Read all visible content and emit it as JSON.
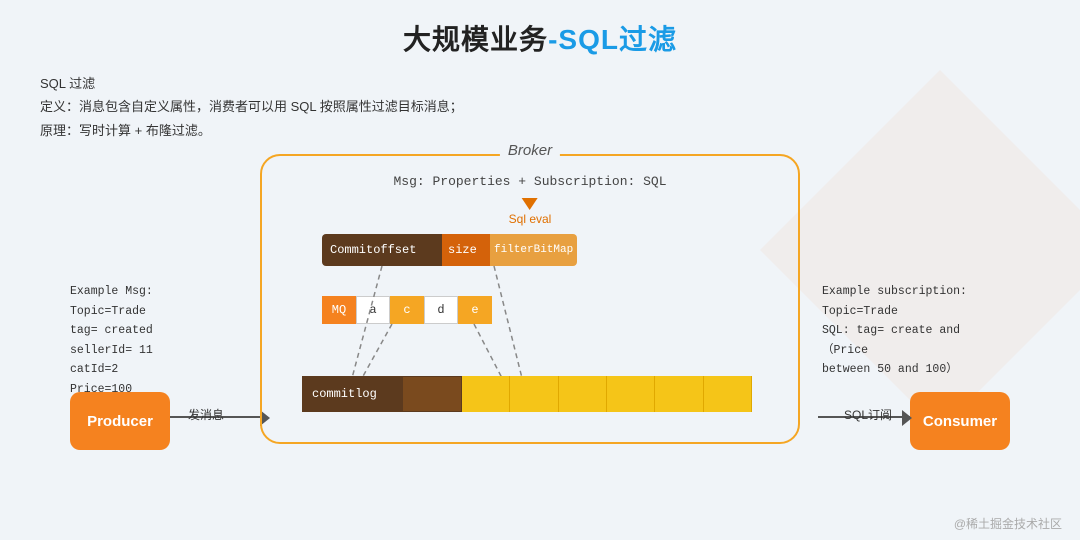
{
  "title": {
    "main": "大规模业务",
    "sub": "-SQL过滤"
  },
  "description": {
    "line1": "SQL 过滤",
    "line2": "定义：消息包含自定义属性，消费者可以用 SQL 按照属性过滤目标消息；",
    "line3": "原理：写时计算 + 布隆过滤。"
  },
  "broker": {
    "label": "Broker",
    "msg_line": "Msg: Properties   +    Subscription: SQL",
    "sql_eval": "Sql eval",
    "commitoffset_label": "Commitoffset",
    "size_label": "size",
    "filter_label": "filterBitMap",
    "mq_label": "MQ",
    "mq_cells": [
      "a",
      "c",
      "d",
      "e"
    ],
    "commitlog_label": "commitlog"
  },
  "example_left": {
    "line1": "Example Msg:",
    "line2": "Topic=Trade",
    "line3": "tag= created",
    "line4": "sellerId= 11",
    "line5": "catId=2",
    "line6": "Price=100"
  },
  "example_right": {
    "line1": "Example subscription:",
    "line2": "Topic=Trade",
    "line3": "SQL:  tag= create and （Price",
    "line4": "between 50 and 100）"
  },
  "producer": {
    "label": "Producer"
  },
  "consumer": {
    "label": "Consumer"
  },
  "fasong_label": "发消息",
  "sqlding_label": "SQL订阅",
  "watermark": "@稀土掘金技术社区",
  "colors": {
    "orange": "#f5821f",
    "dark_brown": "#5c3a1e",
    "yellow": "#f5c518",
    "blue": "#1a9be6",
    "broker_border": "#f5a623"
  }
}
